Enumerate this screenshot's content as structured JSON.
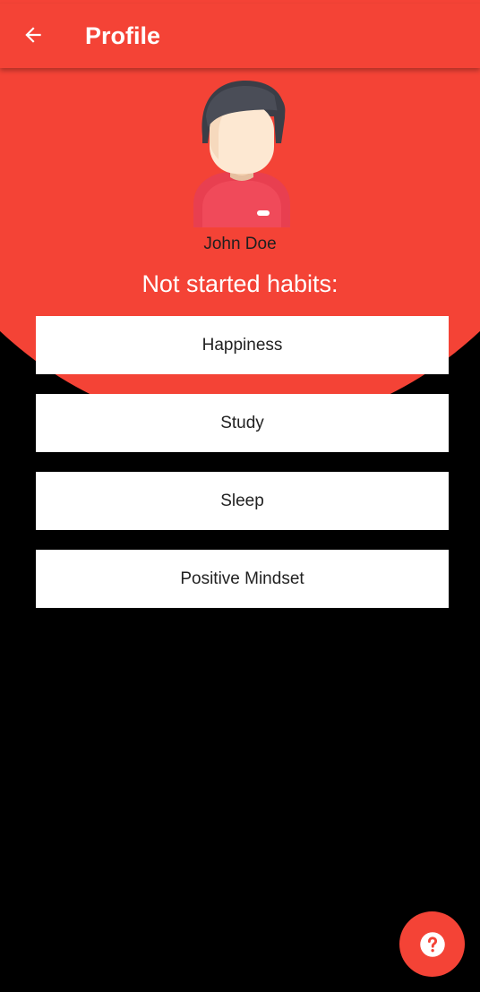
{
  "app_bar": {
    "title": "Profile",
    "back_icon": "arrow-left-icon"
  },
  "profile": {
    "avatar_icon": "user-avatar-icon",
    "name": "John Doe"
  },
  "habits_section": {
    "heading": "Not started habits:",
    "items": [
      {
        "label": "Happiness"
      },
      {
        "label": "Study"
      },
      {
        "label": "Sleep"
      },
      {
        "label": "Positive Mindset"
      }
    ]
  },
  "fab": {
    "icon": "help-circle-icon"
  },
  "colors": {
    "primary": "#f44336",
    "background": "#000000",
    "card": "#ffffff"
  }
}
